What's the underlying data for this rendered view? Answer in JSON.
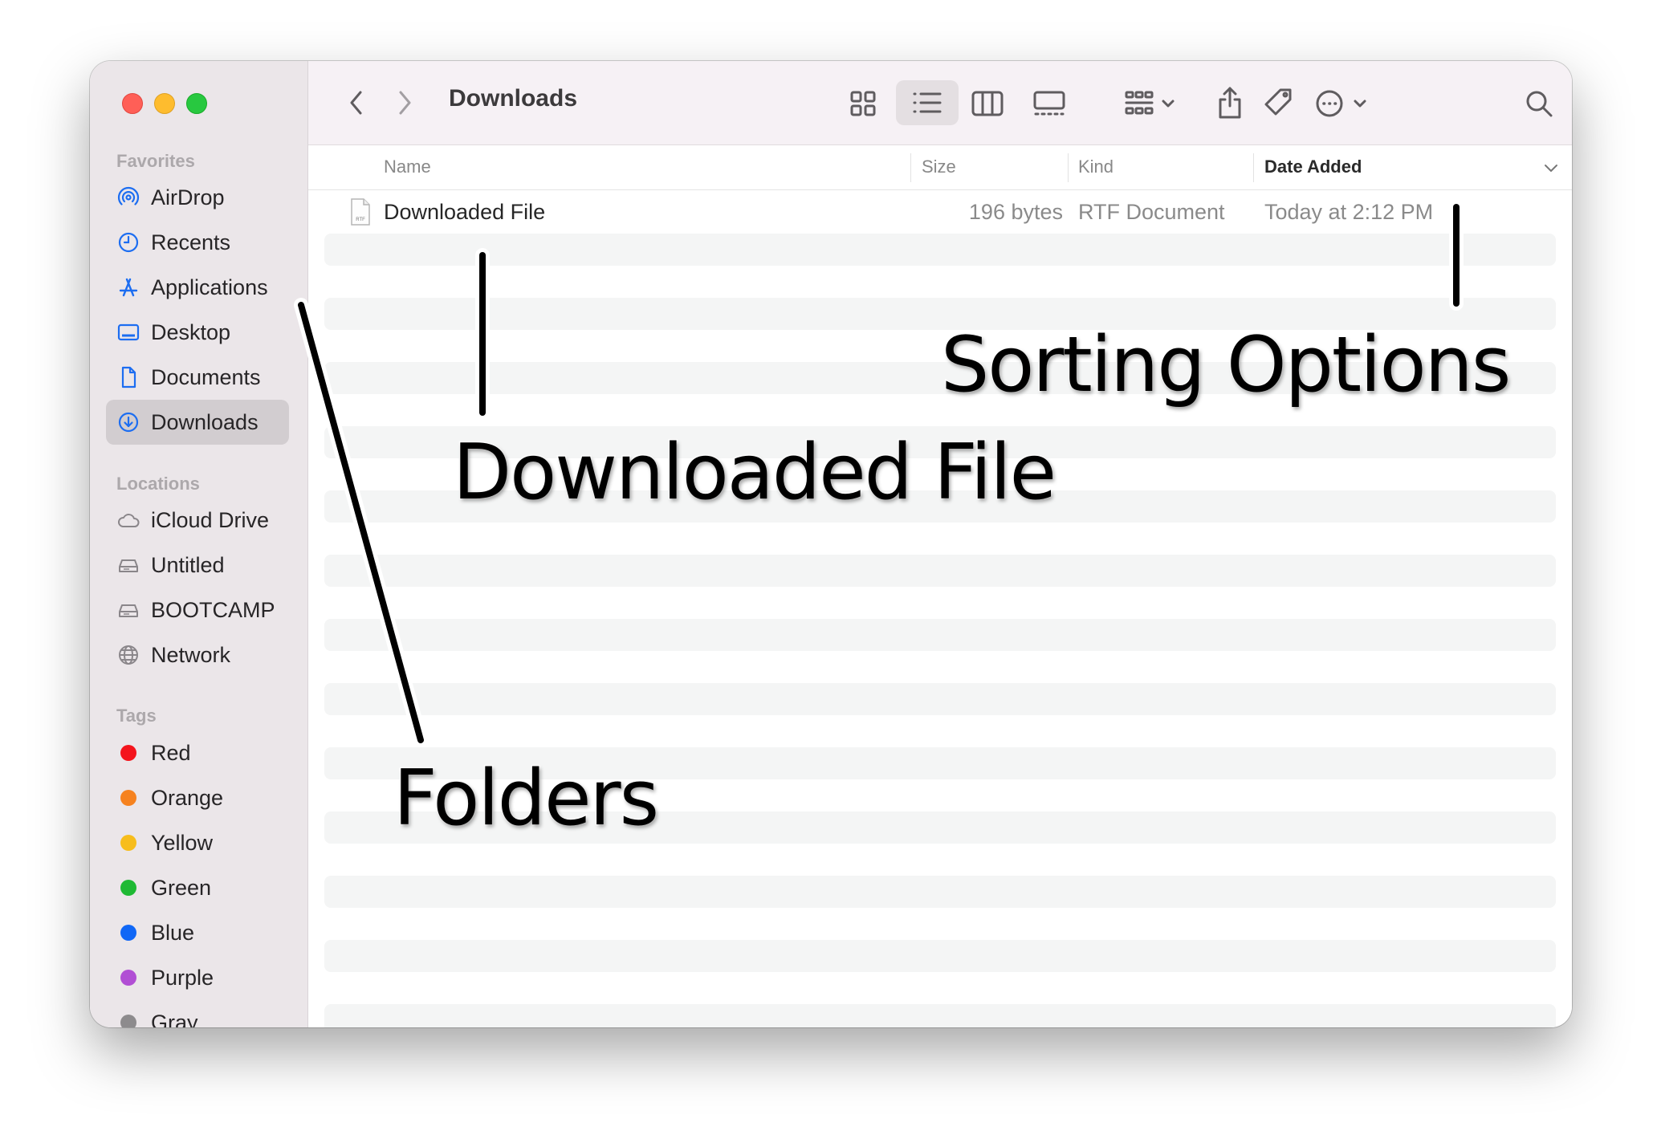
{
  "toolbar": {
    "title": "Downloads"
  },
  "sidebar": {
    "favorites_label": "Favorites",
    "favorites": [
      {
        "label": "AirDrop",
        "icon": "airdrop-icon"
      },
      {
        "label": "Recents",
        "icon": "clock-icon"
      },
      {
        "label": "Applications",
        "icon": "applications-icon"
      },
      {
        "label": "Desktop",
        "icon": "desktop-icon"
      },
      {
        "label": "Documents",
        "icon": "document-icon"
      },
      {
        "label": "Downloads",
        "icon": "download-icon",
        "selected": true
      }
    ],
    "locations_label": "Locations",
    "locations": [
      {
        "label": "iCloud Drive",
        "icon": "cloud-icon"
      },
      {
        "label": "Untitled",
        "icon": "disk-icon"
      },
      {
        "label": "BOOTCAMP",
        "icon": "disk-icon"
      },
      {
        "label": "Network",
        "icon": "globe-icon"
      }
    ],
    "tags_label": "Tags",
    "tags": [
      {
        "label": "Red",
        "color": "#f4141c"
      },
      {
        "label": "Orange",
        "color": "#f6821f"
      },
      {
        "label": "Yellow",
        "color": "#f7bd1c"
      },
      {
        "label": "Green",
        "color": "#1fb934"
      },
      {
        "label": "Blue",
        "color": "#1067f6"
      },
      {
        "label": "Purple",
        "color": "#b14ed4"
      },
      {
        "label": "Gray",
        "color": "#8d8b8d"
      }
    ]
  },
  "columns": {
    "name": "Name",
    "size": "Size",
    "kind": "Kind",
    "date": "Date Added"
  },
  "files": [
    {
      "name": "Downloaded File",
      "size": "196 bytes",
      "kind": "RTF Document",
      "date": "Today at 2:12 PM",
      "icon_label": "RTF"
    }
  ],
  "annotations": {
    "sorting": "Sorting Options",
    "downloaded": "Downloaded File",
    "folders": "Folders"
  }
}
